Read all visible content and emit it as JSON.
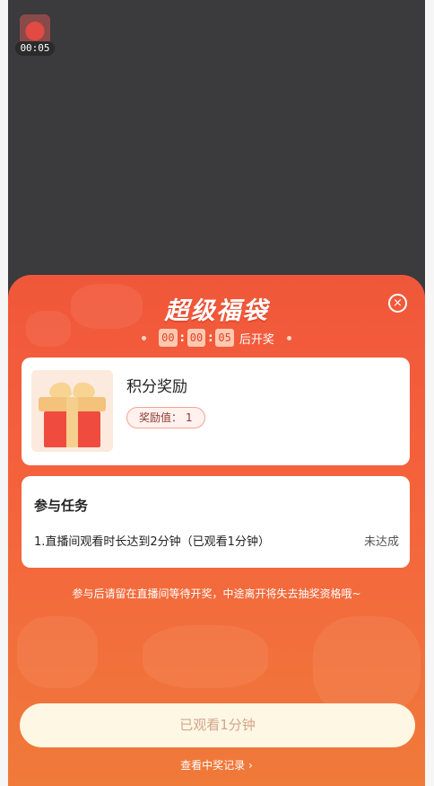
{
  "floating": {
    "timer": "00:05"
  },
  "panel": {
    "title": "超级福袋",
    "countdown": {
      "h": "00",
      "m": "00",
      "s": "05",
      "suffix": "后开奖"
    },
    "reward": {
      "name": "积分奖励",
      "badge_label": "奖励值：",
      "badge_value": "1"
    },
    "task": {
      "title": "参与任务",
      "desc": "1.直播间观看时长达到2分钟（已观看1分钟）",
      "status": "未达成"
    },
    "notice": "参与后请留在直播间等待开奖，中途离开将失去抽奖资格哦~",
    "button_label": "已观看1分钟",
    "records_label": "查看中奖记录"
  },
  "colors": {
    "panel_top": "#f0573a",
    "panel_bottom": "#f07a3a",
    "button_bg": "#fdf7e4"
  }
}
